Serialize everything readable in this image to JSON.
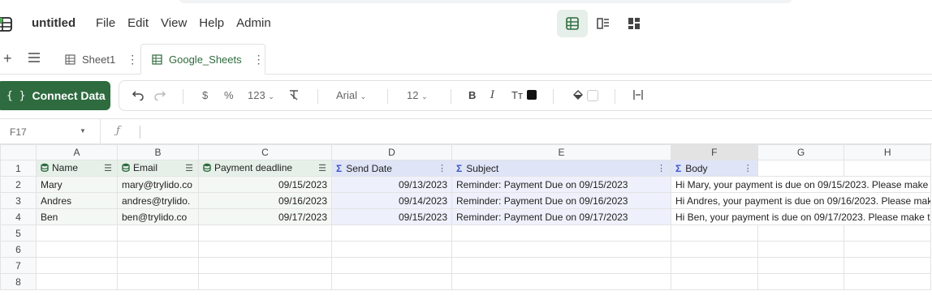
{
  "app": {
    "doc_title": "untitled",
    "menu": [
      "File",
      "Edit",
      "View",
      "Help",
      "Admin"
    ]
  },
  "tabs": [
    {
      "label": "Sheet1",
      "active": false
    },
    {
      "label": "Google_Sheets",
      "active": true
    }
  ],
  "toolbar": {
    "connect_label": "Connect Data",
    "currency": "$",
    "percent": "%",
    "number_format": "123",
    "font": "Arial",
    "font_size": "12",
    "bold": "B",
    "italic": "I",
    "text_size": "Tт"
  },
  "formula_bar": {
    "cell_ref": "F17",
    "fx": "ƒ"
  },
  "colors": {
    "accent_green": "#2e6b3f",
    "source_header": "#e6f0e8",
    "formula_header": "#dfe4f7"
  },
  "grid": {
    "columns": [
      "A",
      "B",
      "C",
      "D",
      "E",
      "F",
      "G",
      "H"
    ],
    "row_numbers": [
      "1",
      "2",
      "3",
      "4",
      "5",
      "6",
      "7",
      "8"
    ],
    "headers": [
      "Name",
      "Email",
      "Payment deadline",
      "Send Date",
      "Subject",
      "Body"
    ],
    "rows": [
      [
        "Mary",
        "mary@trylido.co",
        "09/15/2023",
        "09/13/2023",
        "Reminder: Payment Due on 09/15/2023",
        "Hi Mary, your payment is due on 09/15/2023. Please make t"
      ],
      [
        "Andres",
        "andres@trylido.",
        "09/16/2023",
        "09/14/2023",
        "Reminder: Payment Due on 09/16/2023",
        "Hi Andres, your payment is due on 09/16/2023. Please mak"
      ],
      [
        "Ben",
        "ben@trylido.co",
        "09/17/2023",
        "09/15/2023",
        "Reminder: Payment Due on 09/17/2023",
        "Hi Ben, your payment is due on 09/17/2023. Please make th"
      ]
    ]
  }
}
